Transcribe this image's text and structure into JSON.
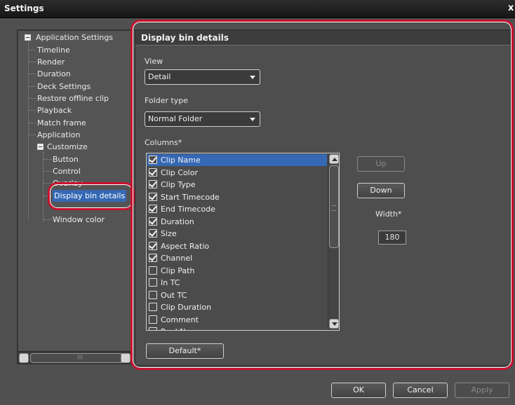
{
  "window": {
    "title": "Settings",
    "close_glyph": "x"
  },
  "tree": {
    "items": [
      {
        "label": "Application Settings"
      },
      {
        "label": "Timeline"
      },
      {
        "label": "Render"
      },
      {
        "label": "Duration"
      },
      {
        "label": "Deck Settings"
      },
      {
        "label": "Restore offline clip"
      },
      {
        "label": "Playback"
      },
      {
        "label": "Match frame"
      },
      {
        "label": "Application"
      },
      {
        "label": "Customize"
      },
      {
        "label": "Button"
      },
      {
        "label": "Control"
      },
      {
        "label": "Overlay"
      },
      {
        "label": "Display bin details"
      },
      {
        "label": "Window color"
      }
    ],
    "scroll_thumb_glyph": "III"
  },
  "panel": {
    "header": "Display bin details",
    "view_label": "View",
    "view_value": "Detail",
    "folder_type_label": "Folder type",
    "folder_type_value": "Normal Folder",
    "columns_label": "Columns*",
    "columns": [
      {
        "label": "Clip Name",
        "checked": true,
        "selected": true
      },
      {
        "label": "Clip Color",
        "checked": true
      },
      {
        "label": "Clip Type",
        "checked": true
      },
      {
        "label": "Start Timecode",
        "checked": true
      },
      {
        "label": "End Timecode",
        "checked": true
      },
      {
        "label": "Duration",
        "checked": true
      },
      {
        "label": "Size",
        "checked": true
      },
      {
        "label": "Aspect Ratio",
        "checked": true
      },
      {
        "label": "Channel",
        "checked": true
      },
      {
        "label": "Clip Path",
        "checked": false
      },
      {
        "label": "In TC",
        "checked": false
      },
      {
        "label": "Out TC",
        "checked": false
      },
      {
        "label": "Clip Duration",
        "checked": false
      },
      {
        "label": "Comment",
        "checked": false
      },
      {
        "label": "Reel No",
        "checked": false
      }
    ],
    "up_label": "Up",
    "down_label": "Down",
    "width_label": "Width*",
    "width_value": "180",
    "default_label": "Default*"
  },
  "footer": {
    "ok_label": "OK",
    "cancel_label": "Cancel",
    "apply_label": "Apply"
  },
  "colors": {
    "selection": "#3568b5",
    "highlight_ring": "#c8102e"
  }
}
